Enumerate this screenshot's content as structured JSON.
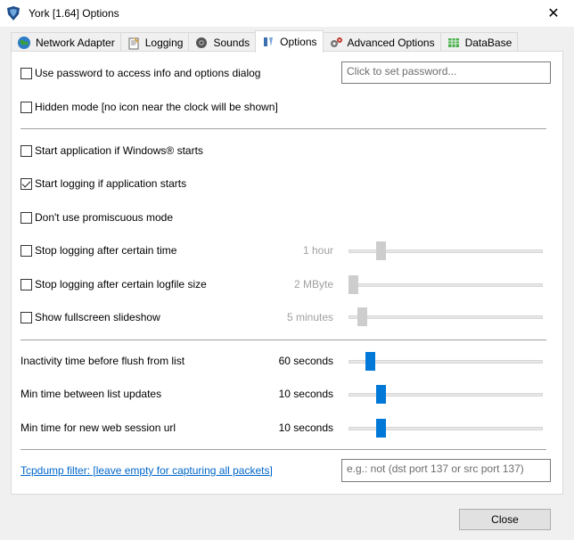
{
  "window": {
    "title": "York [1.64] Options"
  },
  "tabs": [
    {
      "label": "Network Adapter",
      "icon": "globe-icon"
    },
    {
      "label": "Logging",
      "icon": "notepad-icon"
    },
    {
      "label": "Sounds",
      "icon": "speaker-icon"
    },
    {
      "label": "Options",
      "icon": "options-icon",
      "active": true
    },
    {
      "label": "Advanced Options",
      "icon": "gears-icon"
    },
    {
      "label": "DataBase",
      "icon": "database-icon"
    }
  ],
  "options": {
    "use_password": {
      "label": "Use password to access info and options dialog",
      "checked": false
    },
    "password_placeholder": "Click to set password...",
    "hidden_mode": {
      "label": "Hidden mode [no icon near the clock will be shown]",
      "checked": false
    },
    "start_app": {
      "label": "Start application if Windows® starts",
      "checked": false
    },
    "start_logging": {
      "label": "Start logging if application starts",
      "checked": true
    },
    "no_promiscuous": {
      "label": "Don't use promiscuous mode",
      "checked": false
    },
    "stop_time": {
      "label": "Stop logging after certain time",
      "checked": false,
      "value": "1 hour",
      "level": 0.15
    },
    "stop_size": {
      "label": "Stop logging after certain logfile size",
      "checked": false,
      "value": "2 MByte",
      "level": 0.0
    },
    "fullscreen": {
      "label": "Show fullscreen slideshow",
      "checked": false,
      "value": "5 minutes",
      "level": 0.05
    }
  },
  "timing": {
    "inactivity": {
      "label": "Inactivity time before flush from list",
      "value": "60 seconds",
      "level": 0.09
    },
    "list_updates": {
      "label": "Min time between list updates",
      "value": "10 seconds",
      "level": 0.15
    },
    "web_session": {
      "label": "Min time for new web session url",
      "value": "10 seconds",
      "level": 0.15
    }
  },
  "tcpdump": {
    "link": "Tcpdump filter: [leave empty for capturing all packets]",
    "placeholder": "e.g.: not (dst port 137 or src port 137)"
  },
  "buttons": {
    "close": "Close"
  }
}
